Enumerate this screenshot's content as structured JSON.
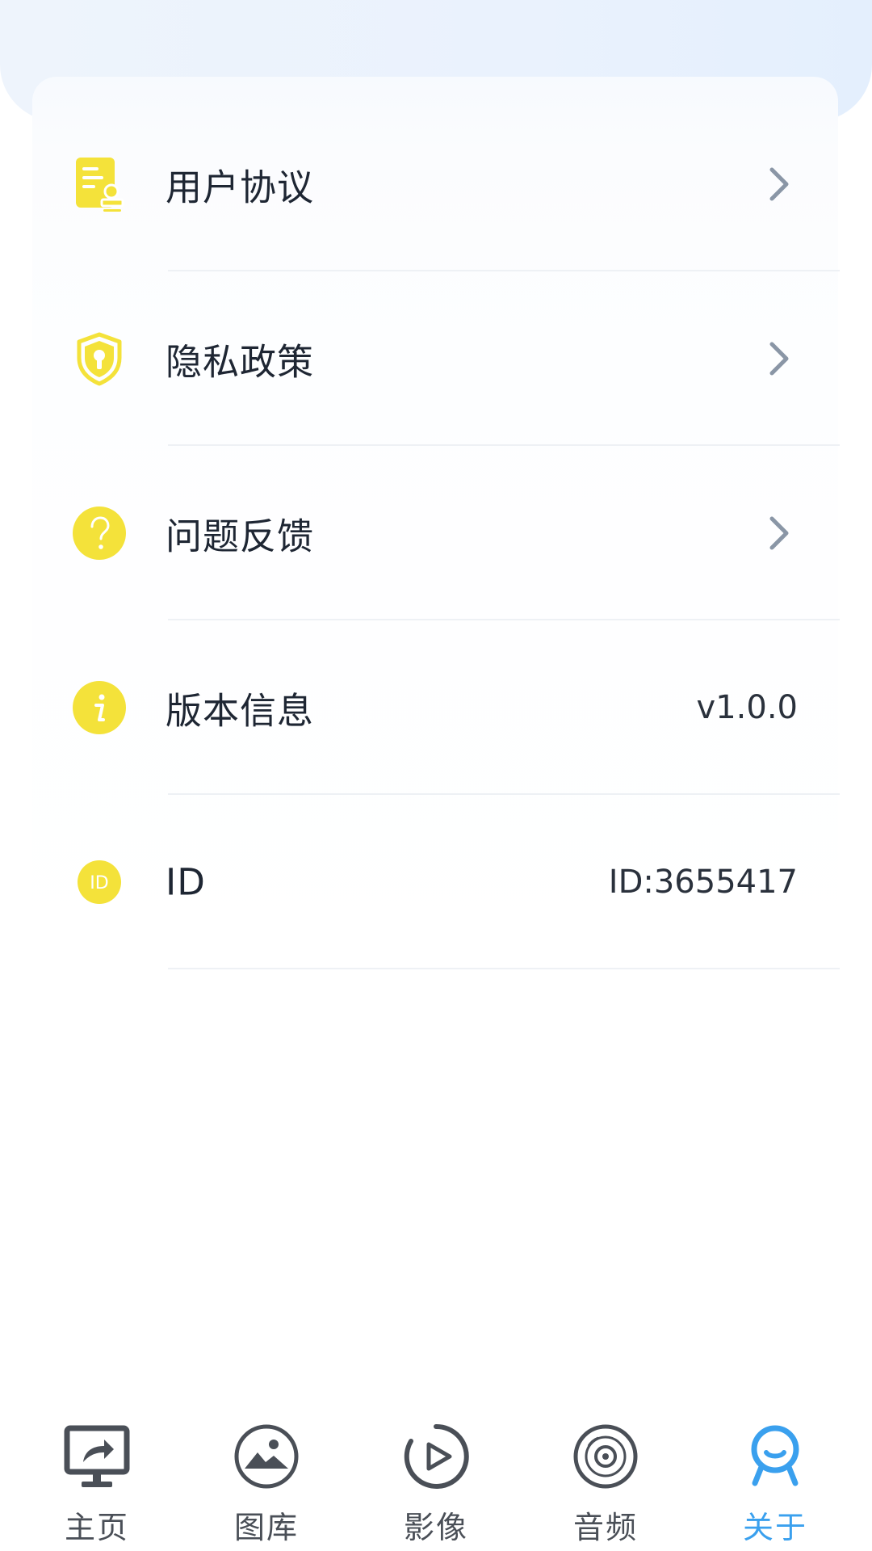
{
  "menu": {
    "items": [
      {
        "label": "用户协议",
        "icon": "document-stamp-icon",
        "has_chevron": true
      },
      {
        "label": "隐私政策",
        "icon": "shield-lock-icon",
        "has_chevron": true
      },
      {
        "label": "问题反馈",
        "icon": "question-circle-icon",
        "has_chevron": true
      },
      {
        "label": "版本信息",
        "icon": "info-circle-icon",
        "value": "v1.0.0"
      },
      {
        "label": "ID",
        "icon": "id-badge-icon",
        "value": "ID:3655417"
      }
    ]
  },
  "tabbar": {
    "tabs": [
      {
        "label": "主页",
        "icon": "screen-share-icon"
      },
      {
        "label": "图库",
        "icon": "gallery-icon"
      },
      {
        "label": "影像",
        "icon": "play-circle-icon"
      },
      {
        "label": "音频",
        "icon": "disc-icon"
      },
      {
        "label": "关于",
        "icon": "smiley-user-icon",
        "active": true
      }
    ]
  },
  "colors": {
    "icon_yellow": "#F4E23A",
    "active_blue": "#3AA0EE",
    "text_dark": "#1E2633",
    "chevron_gray": "#8A96A6",
    "tab_gray": "#4A4F57"
  }
}
